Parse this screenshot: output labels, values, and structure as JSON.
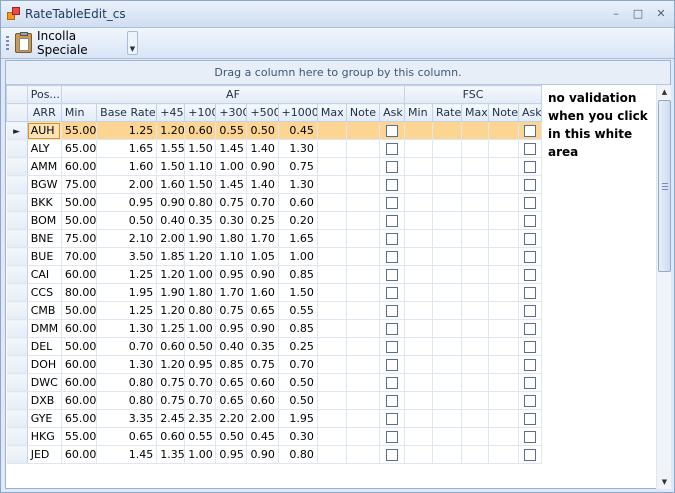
{
  "window": {
    "title": "RateTableEdit_cs",
    "controls": {
      "minimize": "–",
      "maximize": "□",
      "close": "✕"
    }
  },
  "toolbar": {
    "paste_special_label": "Incolla Speciale",
    "dropdown_glyph": "▼"
  },
  "group_panel": {
    "text": "Drag a column here to group by this column."
  },
  "bands": {
    "pos": "Pos...",
    "af": "AF",
    "fsc": "FSC"
  },
  "columns": [
    "ARR",
    "Min",
    "Base Rate",
    "+45",
    "+100",
    "+300",
    "+500",
    "+1000",
    "Max",
    "Note",
    "Ask",
    "Min",
    "Rate",
    "Max",
    "Note",
    "Ask"
  ],
  "rows": [
    {
      "arr": "AUH",
      "min": "55.00",
      "base": "1.25",
      "p45": "1.20",
      "p100": "0.60",
      "p300": "0.55",
      "p500": "0.50",
      "p1000": "0.45"
    },
    {
      "arr": "ALY",
      "min": "65.00",
      "base": "1.65",
      "p45": "1.55",
      "p100": "1.50",
      "p300": "1.45",
      "p500": "1.40",
      "p1000": "1.30"
    },
    {
      "arr": "AMM",
      "min": "60.00",
      "base": "1.60",
      "p45": "1.50",
      "p100": "1.10",
      "p300": "1.00",
      "p500": "0.90",
      "p1000": "0.75"
    },
    {
      "arr": "BGW",
      "min": "75.00",
      "base": "2.00",
      "p45": "1.60",
      "p100": "1.50",
      "p300": "1.45",
      "p500": "1.40",
      "p1000": "1.30"
    },
    {
      "arr": "BKK",
      "min": "50.00",
      "base": "0.95",
      "p45": "0.90",
      "p100": "0.80",
      "p300": "0.75",
      "p500": "0.70",
      "p1000": "0.60"
    },
    {
      "arr": "BOM",
      "min": "50.00",
      "base": "0.50",
      "p45": "0.40",
      "p100": "0.35",
      "p300": "0.30",
      "p500": "0.25",
      "p1000": "0.20"
    },
    {
      "arr": "BNE",
      "min": "75.00",
      "base": "2.10",
      "p45": "2.00",
      "p100": "1.90",
      "p300": "1.80",
      "p500": "1.70",
      "p1000": "1.65"
    },
    {
      "arr": "BUE",
      "min": "70.00",
      "base": "3.50",
      "p45": "1.85",
      "p100": "1.20",
      "p300": "1.10",
      "p500": "1.05",
      "p1000": "1.00"
    },
    {
      "arr": "CAI",
      "min": "60.00",
      "base": "1.25",
      "p45": "1.20",
      "p100": "1.00",
      "p300": "0.95",
      "p500": "0.90",
      "p1000": "0.85"
    },
    {
      "arr": "CCS",
      "min": "80.00",
      "base": "1.95",
      "p45": "1.90",
      "p100": "1.80",
      "p300": "1.70",
      "p500": "1.60",
      "p1000": "1.50"
    },
    {
      "arr": "CMB",
      "min": "50.00",
      "base": "1.25",
      "p45": "1.20",
      "p100": "0.80",
      "p300": "0.75",
      "p500": "0.65",
      "p1000": "0.55"
    },
    {
      "arr": "DMM",
      "min": "60.00",
      "base": "1.30",
      "p45": "1.25",
      "p100": "1.00",
      "p300": "0.95",
      "p500": "0.90",
      "p1000": "0.85"
    },
    {
      "arr": "DEL",
      "min": "50.00",
      "base": "0.70",
      "p45": "0.60",
      "p100": "0.50",
      "p300": "0.40",
      "p500": "0.35",
      "p1000": "0.25"
    },
    {
      "arr": "DOH",
      "min": "60.00",
      "base": "1.30",
      "p45": "1.20",
      "p100": "0.95",
      "p300": "0.85",
      "p500": "0.75",
      "p1000": "0.70"
    },
    {
      "arr": "DWC",
      "min": "60.00",
      "base": "0.80",
      "p45": "0.75",
      "p100": "0.70",
      "p300": "0.65",
      "p500": "0.60",
      "p1000": "0.50"
    },
    {
      "arr": "DXB",
      "min": "60.00",
      "base": "0.80",
      "p45": "0.75",
      "p100": "0.70",
      "p300": "0.65",
      "p500": "0.60",
      "p1000": "0.50"
    },
    {
      "arr": "GYE",
      "min": "65.00",
      "base": "3.35",
      "p45": "2.45",
      "p100": "2.35",
      "p300": "2.20",
      "p500": "2.00",
      "p1000": "1.95"
    },
    {
      "arr": "HKG",
      "min": "55.00",
      "base": "0.65",
      "p45": "0.60",
      "p100": "0.55",
      "p300": "0.50",
      "p500": "0.45",
      "p1000": "0.30"
    },
    {
      "arr": "JED",
      "min": "60.00",
      "base": "1.45",
      "p45": "1.35",
      "p100": "1.00",
      "p300": "0.95",
      "p500": "0.90",
      "p1000": "0.80"
    }
  ],
  "selected_row_indicator": "►",
  "side_note": "no validation when you click in this white area",
  "colors": {
    "selected_row": "#fdd593",
    "header_text": "#1c2f49",
    "focus_border": "#e39017"
  },
  "scrollbar": {
    "up": "▲",
    "down": "▼"
  }
}
